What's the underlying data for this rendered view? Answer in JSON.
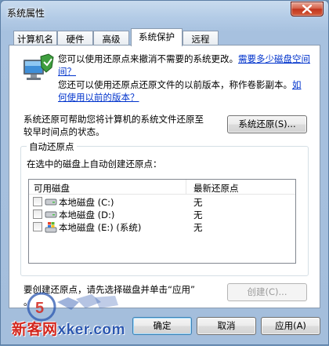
{
  "window": {
    "title": "系统属性"
  },
  "tabs": [
    {
      "label": "计算机名"
    },
    {
      "label": "硬件"
    },
    {
      "label": "高级"
    },
    {
      "label": "系统保护"
    },
    {
      "label": "远程"
    }
  ],
  "active_tab": "系统保护",
  "info": {
    "line1_text": "您可以使用还原点来撤消不需要的系统更改。",
    "line1_link": "需要多少磁盘空间",
    "line1_link_cont": "间？",
    "line2_text": "您还可以使用还原点还原文件的以前版本，称作卷影副本。",
    "line2_link_a": "如",
    "line2_link_b": "何使用以前的版本？"
  },
  "restore": {
    "desc_line1": "系统还原可帮助您将计算机的系统文件还原至",
    "desc_line2": "较早时间点的状态。",
    "button_label": "系统还原(S)..."
  },
  "auto_restore": {
    "group_label": "自动还原点",
    "instruction": "在选中的磁盘上自动创建还原点：",
    "columns": [
      "可用磁盘",
      "最新还原点"
    ],
    "rows": [
      {
        "disk": "本地磁盘 (C:)",
        "latest": "无",
        "checked": false,
        "icon": "hard-drive-icon"
      },
      {
        "disk": "本地磁盘 (D:)",
        "latest": "无",
        "checked": false,
        "icon": "hard-drive-icon"
      },
      {
        "disk": "本地磁盘 (E:) (系统)",
        "latest": "无",
        "checked": false,
        "icon": "windows-drive-icon"
      }
    ]
  },
  "create": {
    "text_line1": "要创建还原点，请先选择磁盘并单击“应用”",
    "text_line2": "。",
    "button_label": "创建(C)..."
  },
  "footer": {
    "ok_label": "确定",
    "cancel_label": "取消",
    "apply_label": "应用(A)"
  },
  "watermark": {
    "brand": "新客网",
    "domain": "xker.com"
  },
  "colors": {
    "link": "#0033cc",
    "close_button": "#c2361f",
    "watermark_red": "#d3261d",
    "watermark_blue": "#2b57b0"
  }
}
